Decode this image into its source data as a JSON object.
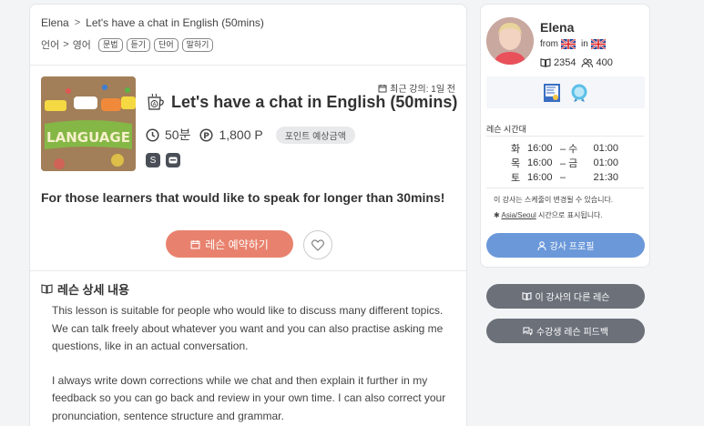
{
  "breadcrumb": {
    "teacher": "Elena",
    "lesson": "Let's have a chat in English (50mins)"
  },
  "category": {
    "parent": "언어",
    "child": "영어",
    "tags": [
      "문법",
      "듣기",
      "단어",
      "말하기"
    ]
  },
  "lesson": {
    "recent": "최근 강의: 1일 전",
    "title": "Let's have a chat in English (50mins)",
    "duration": "50분",
    "price": "1,800 P",
    "price_pill": "포인트 예상금액",
    "thumbnail_text": "LANGUAGE",
    "headline": "For those learners that would like to speak for longer than 30mins!",
    "book_label": "레슨 예약하기",
    "detail_heading": "레슨 상세 내용",
    "description": [
      "This lesson is suitable for people who would like to discuss many different topics. We can talk freely about whatever you want and you can also practise asking me questions, like in an actual conversation.",
      "I always write down corrections while we chat and then explain it further in my feedback so you can go back and review in your own time. I can also correct your pronunciation, sentence structure and grammar."
    ]
  },
  "teacher": {
    "name": "Elena",
    "from_label": "from",
    "in_label": "in",
    "lessons": "2354",
    "students": "400"
  },
  "schedule": {
    "heading": "레슨 시간대",
    "rows": [
      {
        "day": "화",
        "start": "16:00",
        "sep": "– 수",
        "end": "01:00"
      },
      {
        "day": "목",
        "start": "16:00",
        "sep": "– 금",
        "end": "01:00"
      },
      {
        "day": "토",
        "start": "16:00",
        "sep": "–",
        "end": "21:30"
      }
    ],
    "note1": "이 강사는 스케줄이 변경될 수 있습니다.",
    "note2_tz": "Asia/Seoul",
    "note2_rest": " 시간으로 표시됩니다."
  },
  "buttons": {
    "profile": "강사 프로필",
    "other_lessons": "이 강사의 다른 레슨",
    "feedback": "수강생 레슨 피드백"
  },
  "colors": {
    "book": "#e8826e",
    "profile": "#6b98d9",
    "dark": "#6b7079"
  }
}
